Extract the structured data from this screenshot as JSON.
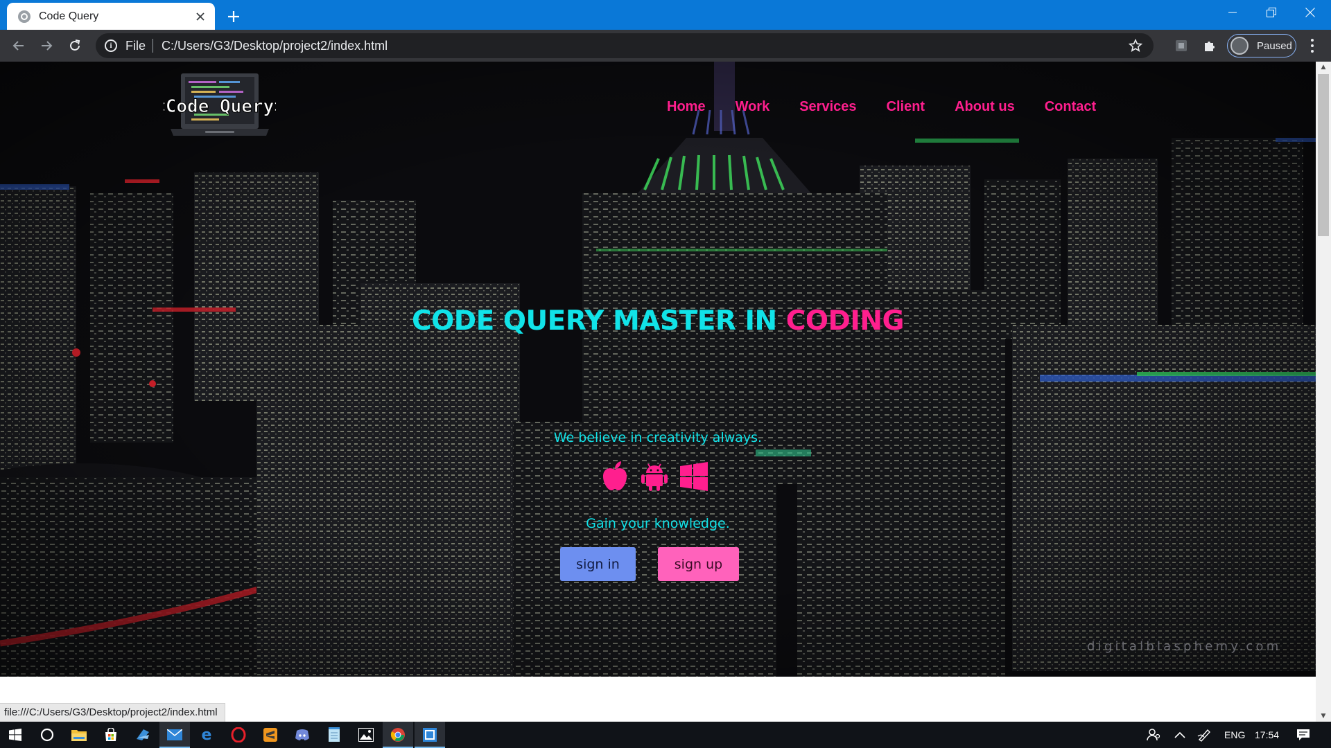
{
  "browser": {
    "tab_title": "Code Query",
    "url_scheme": "File",
    "url": "C:/Users/G3/Desktop/project2/index.html",
    "profile_label": "Paused",
    "status_url": "file:///C:/Users/G3/Desktop/project2/index.html"
  },
  "site": {
    "logo_text": "<Code Query>",
    "nav": [
      "Home",
      "Work",
      "Services",
      "Client",
      "About us",
      "Contact"
    ],
    "headline_main": "CODE QUERY MASTER IN ",
    "headline_accent": "CODING",
    "tagline": "We believe in creativity always.",
    "platform_icons": [
      "apple-icon",
      "android-icon",
      "windows-icon"
    ],
    "tagline2": "Gain your knowledge.",
    "sign_in_label": "sign in",
    "sign_up_label": "sign up",
    "watermark": "digitalblasphemy.com",
    "colors": {
      "accent_cyan": "#11e3e8",
      "accent_pink": "#ff1f8e",
      "button_blue": "#6d8ff0",
      "button_pink": "#ff62bb"
    }
  },
  "taskbar": {
    "apps": [
      "windows-start-icon",
      "cortana-search-icon",
      "file-explorer-icon",
      "microsoft-store-icon",
      "visual-studio-icon",
      "mail-icon",
      "edge-icon",
      "opera-icon",
      "sublime-text-icon",
      "discord-icon",
      "notepad-icon",
      "photos-icon",
      "chrome-icon",
      "code-editor-icon"
    ],
    "language": "ENG",
    "time": "17:54"
  }
}
